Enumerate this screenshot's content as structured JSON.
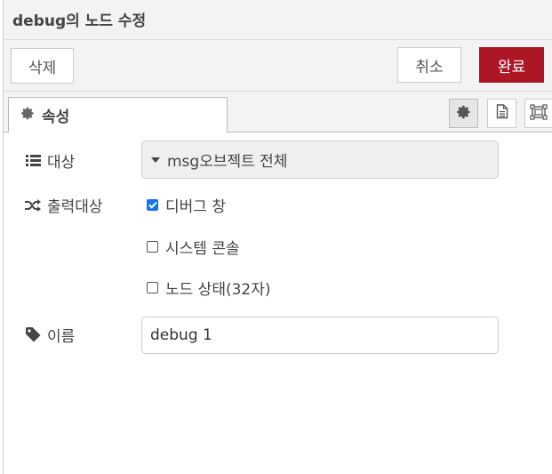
{
  "dialog": {
    "title": "debug의 노드 수정"
  },
  "toolbar": {
    "delete_label": "삭제",
    "cancel_label": "취소",
    "done_label": "완료"
  },
  "tabs": [
    {
      "label": "속성",
      "icon": "gear-icon"
    }
  ],
  "tab_icons": [
    "gear-icon",
    "document-icon",
    "frame-icon"
  ],
  "form": {
    "target": {
      "label": "대상",
      "icon": "list-icon",
      "value": "msg오브젝트 전체"
    },
    "output": {
      "label": "출력대상",
      "icon": "shuffle-icon",
      "options": [
        {
          "label": "디버그 창",
          "checked": true
        },
        {
          "label": "시스템 콘솔",
          "checked": false
        },
        {
          "label": "노드 상태(32자)",
          "checked": false
        }
      ]
    },
    "name": {
      "label": "이름",
      "icon": "tag-icon",
      "value": "debug 1"
    }
  },
  "colors": {
    "primary": "#ad1625",
    "checkbox": "#1a73e8"
  }
}
